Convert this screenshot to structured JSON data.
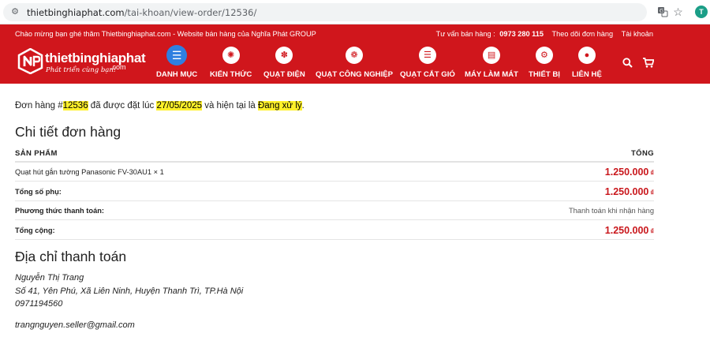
{
  "browser": {
    "url_host": "thietbinghiaphat.com",
    "url_path": "/tai-khoan/view-order/12536/",
    "profile_initial": "T"
  },
  "header": {
    "welcome": "Chào mừng bạn ghé thăm Thietbinghiaphat.com - Website bán hàng của Nghĩa Phát GROUP",
    "hotline_label": "Tư vấn bán hàng :",
    "hotline_number": "0973 280 115",
    "track_order": "Theo dõi đơn hàng",
    "account": "Tài khoản",
    "logo_name": "thietbinghiaphat",
    "logo_com": ".com",
    "logo_slogan": "Phát triển cùng bạn!"
  },
  "nav": [
    {
      "label": "DANH MỤC",
      "icon": "menu-icon"
    },
    {
      "label": "KIẾN THỨC",
      "icon": "lightbulb-icon"
    },
    {
      "label": "QUẠT ĐIỆN",
      "icon": "fan-icon"
    },
    {
      "label": "QUẠT CÔNG NGHIỆP",
      "icon": "industrial-fan-icon"
    },
    {
      "label": "QUẠT CẮT GIÓ",
      "icon": "air-curtain-icon"
    },
    {
      "label": "MÁY LÀM MÁT",
      "icon": "air-cooler-icon"
    },
    {
      "label": "THIẾT BỊ",
      "icon": "device-icon"
    },
    {
      "label": "LIÊN HỆ",
      "icon": "location-pin-icon"
    }
  ],
  "order": {
    "notice_prefix": "Đơn hàng #",
    "order_number": "12536",
    "notice_mid": " đã được đặt lúc ",
    "order_date": "27/05/2025",
    "notice_mid2": " và hiện tại là ",
    "status": "Đang xử lý",
    "notice_end": "."
  },
  "details": {
    "title": "Chi tiết đơn hàng",
    "col_product": "SẢN PHẨM",
    "col_total": "TỔNG",
    "item_name": "Quạt hút gắn tường Panasonic FV-30AU1",
    "item_qty": "× 1",
    "item_total": "1.250.000",
    "subtotal_label": "Tổng số phụ:",
    "subtotal_value": "1.250.000",
    "payment_label": "Phương thức thanh toán:",
    "payment_value": "Thanh toán khi nhận hàng",
    "total_label": "Tổng cộng:",
    "total_value": "1.250.000",
    "currency": "₫"
  },
  "billing": {
    "title": "Địa chỉ thanh toán",
    "name": "Nguyễn Thị Trang",
    "address": "Số 41, Yên Phú, Xã Liên Ninh, Huyện Thanh Trì, TP.Hà Nội",
    "phone": "0971194560",
    "email": "trangnguyen.seller@gmail.com"
  },
  "colors": {
    "brand_red": "#d0161c",
    "active_nav": "#2f7fe0",
    "highlight": "#fef02a",
    "price_red": "#c9171c"
  }
}
